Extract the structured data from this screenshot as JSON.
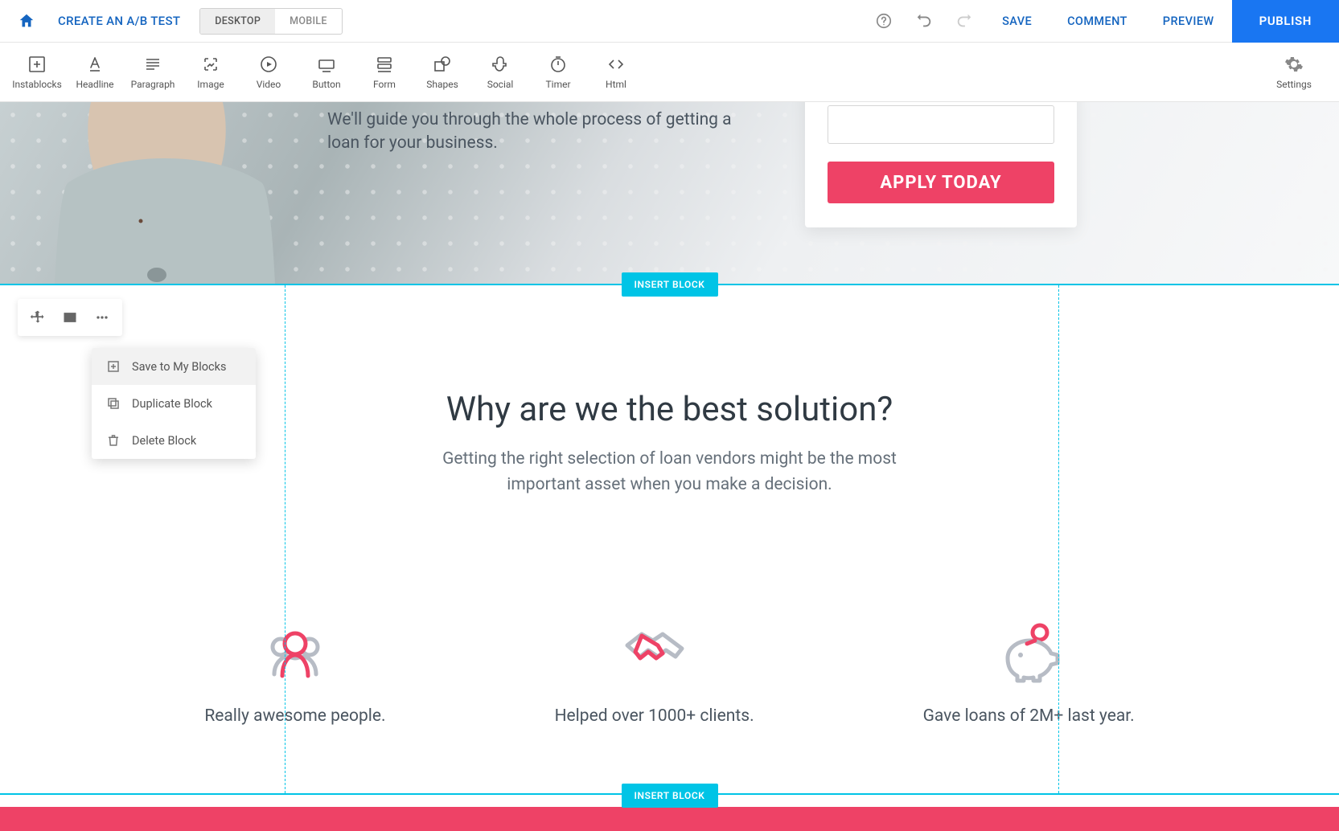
{
  "topbar": {
    "ab_test": "CREATE AN A/B TEST",
    "desktop": "DESKTOP",
    "mobile": "MOBILE",
    "save": "SAVE",
    "comment": "COMMENT",
    "preview": "PREVIEW",
    "publish": "PUBLISH"
  },
  "elembar": {
    "instablocks": "Instablocks",
    "headline": "Headline",
    "paragraph": "Paragraph",
    "image": "Image",
    "video": "Video",
    "button": "Button",
    "form": "Form",
    "shapes": "Shapes",
    "social": "Social",
    "timer": "Timer",
    "html": "Html",
    "settings": "Settings"
  },
  "hero": {
    "line1": "We'll guide you through the whole process of getting a",
    "line2": "loan for your business.",
    "cta": "APPLY TODAY"
  },
  "insert_block": "INSERT BLOCK",
  "solution": {
    "headline": "Why are we the best solution?",
    "sub1": "Getting the right selection of loan vendors might be the most",
    "sub2": "important asset when you make a decision.",
    "feat1": "Really awesome people.",
    "feat2": "Helped over 1000+ clients.",
    "feat3": "Gave loans of 2M+ last year."
  },
  "context_menu": {
    "save": "Save to My Blocks",
    "duplicate": "Duplicate Block",
    "delete": "Delete Block"
  }
}
